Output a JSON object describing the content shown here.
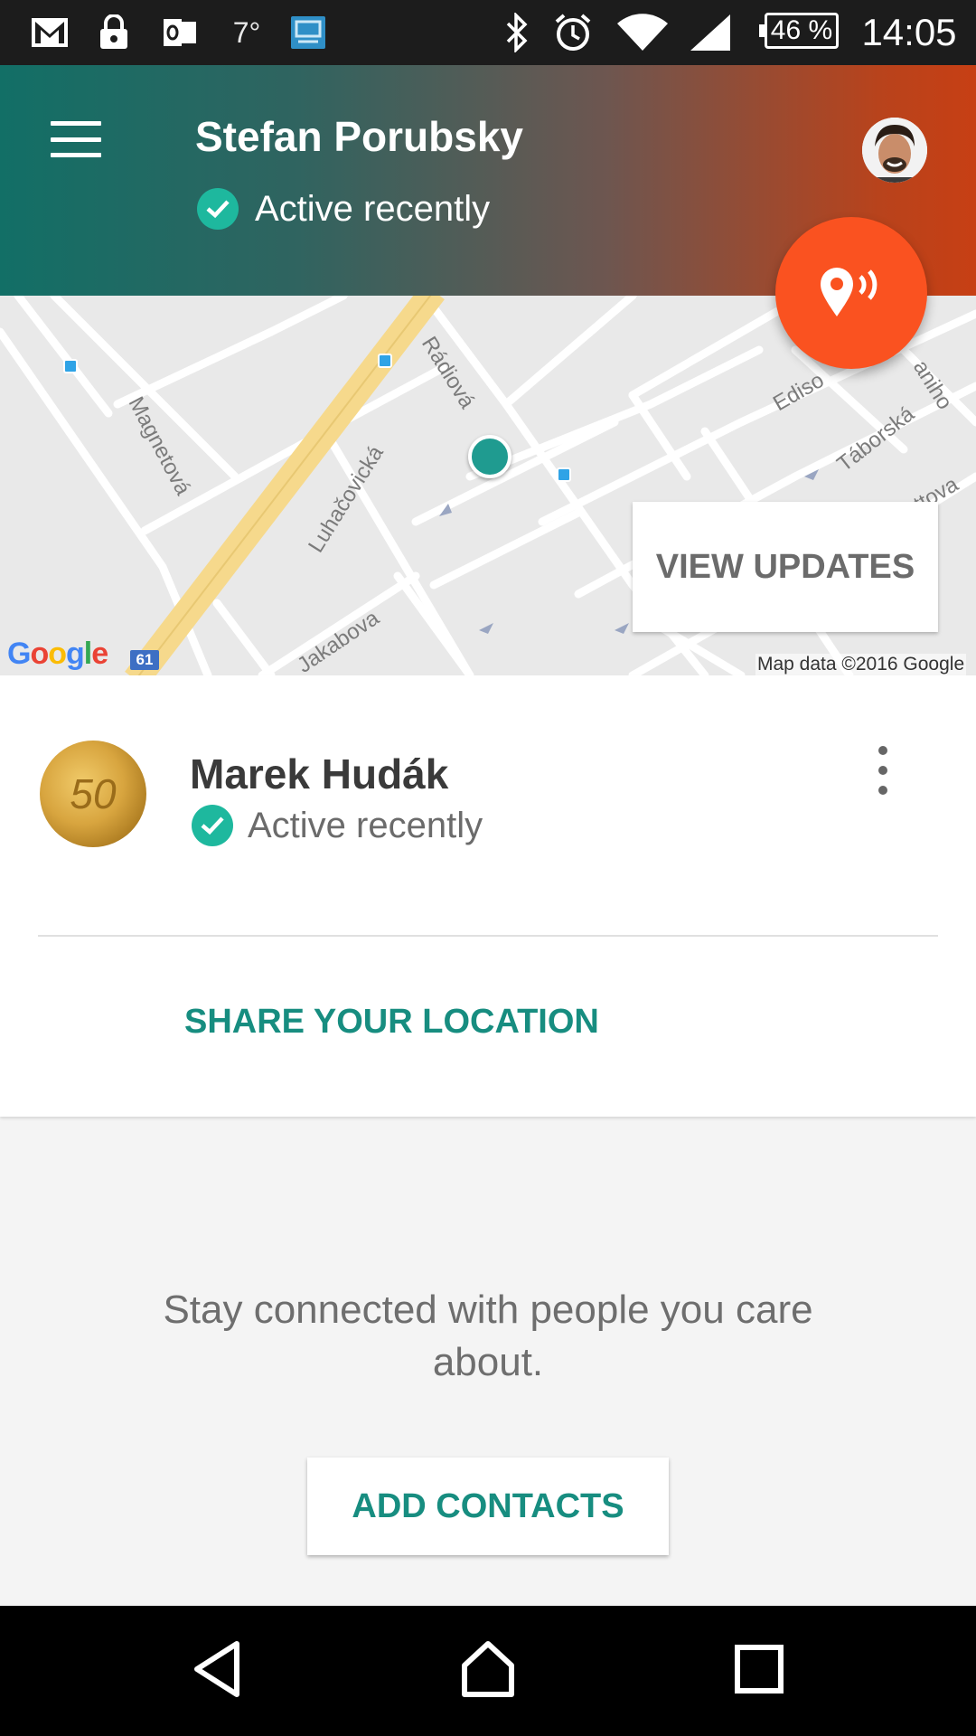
{
  "status_bar": {
    "temperature": "7°",
    "battery": "46 %",
    "time": "14:05",
    "icons": [
      "gmail-icon",
      "lock-icon",
      "outlook-icon",
      "screen-mirror-icon",
      "bluetooth-icon",
      "alarm-icon",
      "wifi-icon",
      "signal-icon"
    ]
  },
  "header": {
    "user_name": "Stefan Porubsky",
    "status": "Active recently",
    "accent": "#fa5220"
  },
  "map": {
    "streets": [
      "Magnetová",
      "Luhačovická",
      "Rádiová",
      "Jakabova",
      "Táborská",
      "Ediso",
      "aniho",
      "attova"
    ],
    "google_logo": "Google",
    "route_number": "61",
    "attribution": "Map data ©2016 Google",
    "view_updates_label": "VIEW UPDATES"
  },
  "contact": {
    "name": "Marek Hudák",
    "status": "Active recently",
    "coin_label": "50",
    "share_label": "SHARE YOUR LOCATION"
  },
  "promo": {
    "text": "Stay connected with people you care about.",
    "add_contacts_label": "ADD CONTACTS"
  },
  "colors": {
    "teal": "#178d80",
    "check_green": "#1eb89e",
    "header_start": "#126f66",
    "header_end": "#c73f14"
  }
}
